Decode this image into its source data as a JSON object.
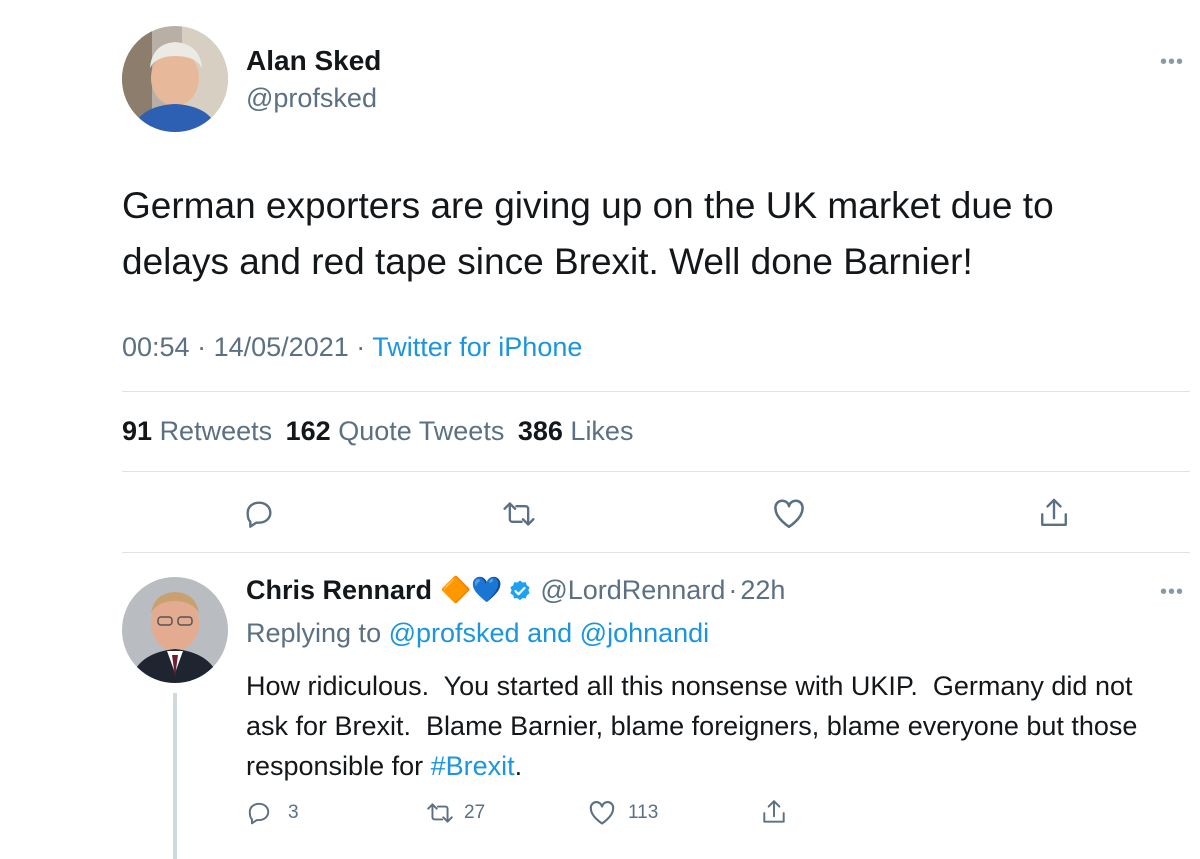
{
  "tweet": {
    "author_name": "Alan Sked",
    "author_handle": "@profsked",
    "text": "German exporters are giving up on the UK market due to delays and red tape since Brexit. Well done Barnier!",
    "time": "00:54",
    "date": "14/05/2021",
    "separator": "·",
    "source": "Twitter for iPhone",
    "stats": {
      "retweets_count": "91",
      "retweets_label": "Retweets",
      "quotes_count": "162",
      "quotes_label": "Quote Tweets",
      "likes_count": "386",
      "likes_label": "Likes"
    },
    "actions": [
      "reply-icon",
      "retweet-icon",
      "like-icon",
      "share-icon"
    ]
  },
  "reply": {
    "author_name": "Chris Rennard",
    "emoji": "🔶💙",
    "author_handle": "@LordRennard",
    "age": "22h",
    "replying_prefix": "Replying to",
    "replying_user1": "@profsked",
    "replying_and": "and",
    "replying_user2": "@johnandi",
    "text_main": "How ridiculous.  You started all this nonsense with UKIP.  Germany did not ask for Brexit.  Blame Barnier, blame foreigners, blame everyone but those responsible for",
    "hashtag": "#Brexit",
    "text_end": ".",
    "counts": {
      "replies": "3",
      "retweets": "27",
      "likes": "113"
    }
  },
  "colors": {
    "accent": "#1b95e0",
    "secondary_text": "#5b7083",
    "verified": "#1da1f2"
  }
}
